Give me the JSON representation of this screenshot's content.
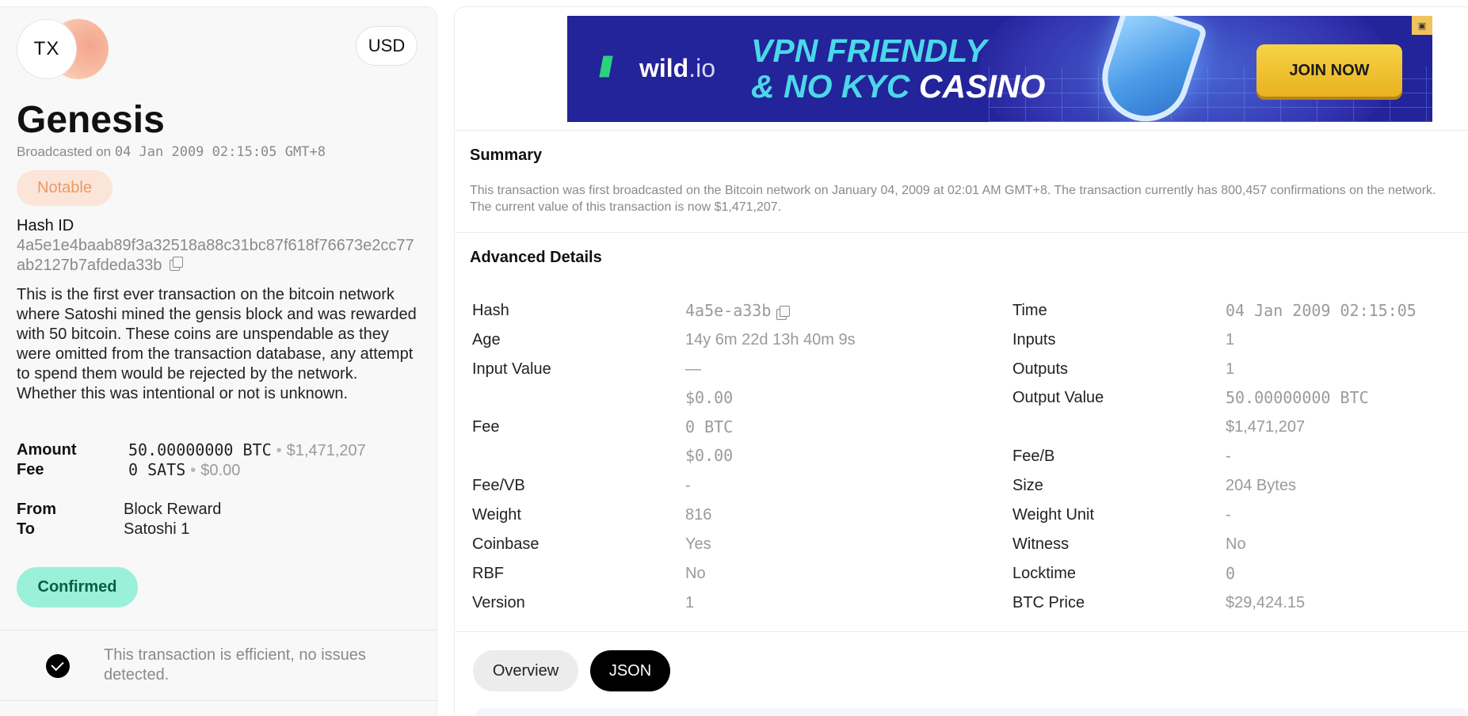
{
  "tx": {
    "logo_text": "TX",
    "currency": "USD",
    "title": "Genesis",
    "broadcast_prefix": "Broadcasted on",
    "broadcast_date": "04 Jan 2009 02:15:05 GMT+8",
    "badge": "Notable",
    "hash_label": "Hash ID",
    "hash_value": "4a5e1e4baab89f3a32518a88c31bc87f618f76673e2cc77ab2127b7afdeda33b",
    "description": "This is the first ever transaction on the bitcoin network where Satoshi mined the gensis block and was rewarded with 50 bitcoin. These coins are unspendable as they were omitted from the transaction database, any attempt to spend them would be rejected by the network. Whether this was intentional or not is unknown.",
    "amount_label": "Amount",
    "amount_btc": "50.00000000 BTC",
    "amount_usd": "$1,471,207",
    "fee_label": "Fee",
    "fee_sats": "0 SATS",
    "fee_usd": "$0.00",
    "from_label": "From",
    "from_value": "Block Reward",
    "to_label": "To",
    "to_value": "Satoshi 1",
    "status": "Confirmed",
    "efficiency_note": "This transaction is efficient, no issues detected."
  },
  "ad": {
    "brand": "wild",
    "brand_suffix": ".io",
    "headline_line1": "VPN FRIENDLY",
    "headline_line2_accent": "& NO KYC",
    "headline_line2_white": "CASINO",
    "cta": "JOIN NOW",
    "colors": {
      "background": "#23239a",
      "accent": "#4bd8e8",
      "cta": "#f2c434",
      "brand": "#2cd37a"
    }
  },
  "summary": {
    "title": "Summary",
    "text": "This transaction was first broadcasted on the Bitcoin network on January 04, 2009 at 02:01 AM GMT+8. The transaction currently has 800,457 confirmations on the network. The current value of this transaction is now $1,471,207."
  },
  "advanced": {
    "title": "Advanced Details",
    "left": [
      {
        "label": "Hash",
        "value": "4a5e-a33b"
      },
      {
        "label": "Age",
        "value": "14y 6m 22d 13h 40m 9s"
      },
      {
        "label": "Input Value",
        "value": "—"
      },
      {
        "label": "",
        "value": "$0.00"
      },
      {
        "label": "Fee",
        "value": "0 BTC"
      },
      {
        "label": "",
        "value": "$0.00"
      },
      {
        "label": "Fee/VB",
        "value": "-"
      },
      {
        "label": "Weight",
        "value": "816"
      },
      {
        "label": "Coinbase",
        "value": "Yes"
      },
      {
        "label": "RBF",
        "value": "No"
      },
      {
        "label": "Version",
        "value": "1"
      }
    ],
    "right": [
      {
        "label": "Time",
        "value": "04 Jan 2009 02:15:05"
      },
      {
        "label": "Inputs",
        "value": "1"
      },
      {
        "label": "Outputs",
        "value": "1"
      },
      {
        "label": "Output Value",
        "value": "50.00000000 BTC"
      },
      {
        "label": "",
        "value": "$1,471,207"
      },
      {
        "label": "Fee/B",
        "value": "-"
      },
      {
        "label": "Size",
        "value": "204 Bytes"
      },
      {
        "label": "Weight Unit",
        "value": "-"
      },
      {
        "label": "Witness",
        "value": "No"
      },
      {
        "label": "Locktime",
        "value": "0"
      },
      {
        "label": "BTC Price",
        "value": "$29,424.15"
      }
    ]
  },
  "tabs": [
    {
      "label": "Overview",
      "active": false
    },
    {
      "label": "JSON",
      "active": true
    }
  ]
}
